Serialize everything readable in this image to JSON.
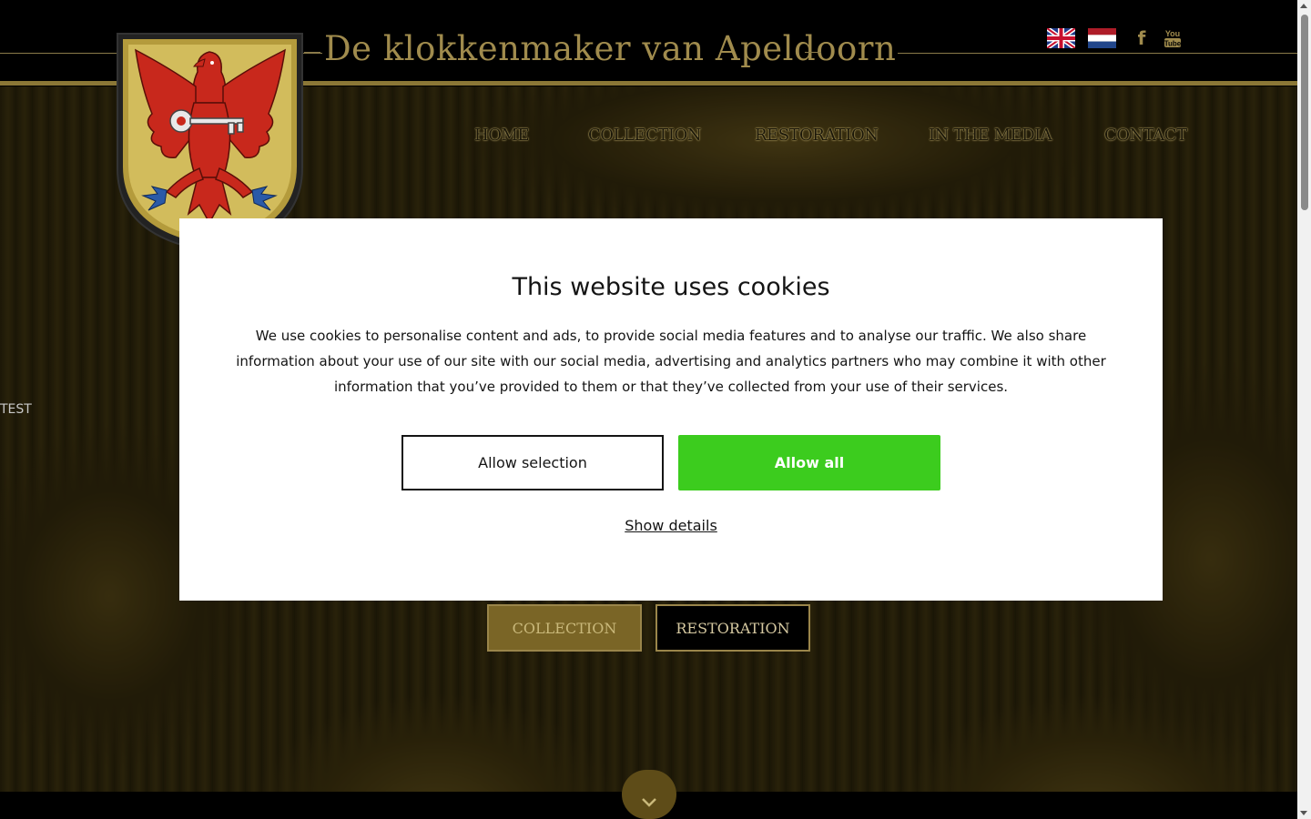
{
  "header": {
    "title": "De klokkenmaker van Apeldoorn",
    "logo_icon": "coat-of-arms-eagle-key-icon",
    "languages": [
      {
        "code": "en",
        "icon": "uk-flag-icon"
      },
      {
        "code": "nl",
        "icon": "netherlands-flag-icon"
      }
    ],
    "social": [
      {
        "icon": "facebook-icon",
        "glyph": "f"
      },
      {
        "icon": "youtube-icon",
        "glyph": "You\nTube"
      }
    ]
  },
  "nav": {
    "items": [
      {
        "label": "HOME"
      },
      {
        "label": "COLLECTION"
      },
      {
        "label": "RESTORATION"
      },
      {
        "label": "IN THE MEDIA"
      },
      {
        "label": "CONTACT"
      }
    ]
  },
  "hero": {
    "test_label": "TEST",
    "buttons": [
      {
        "label": "COLLECTION"
      },
      {
        "label": "RESTORATION"
      }
    ],
    "scroll_icon": "chevron-down-icon"
  },
  "cookie_dialog": {
    "title": "This website uses cookies",
    "text": "We use cookies to personalise content and ads, to provide social media features and to analyse our traffic. We also share information about your use of our site with our social media, advertising and analytics partners who may combine it with other information that you’ve provided to them or that they’ve collected from your use of their services.",
    "allow_selection_label": "Allow selection",
    "allow_all_label": "Allow all",
    "show_details_label": "Show details"
  },
  "colors": {
    "gold": "#a08b4d",
    "allow_all_green": "#3ccc1e"
  }
}
